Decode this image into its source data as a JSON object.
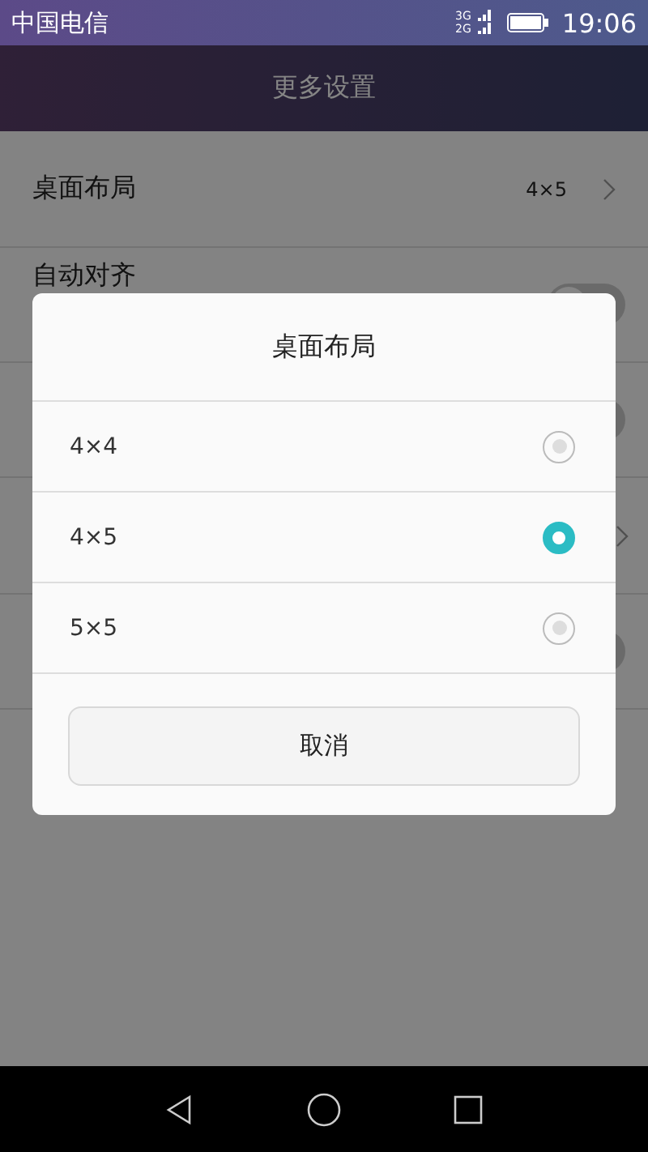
{
  "status_bar": {
    "carrier": "中国电信",
    "network_top": "3G",
    "network_bottom": "2G",
    "time": "19:06"
  },
  "header": {
    "title": "更多设置"
  },
  "settings": [
    {
      "kind": "value",
      "label": "桌面布局",
      "value": "4×5"
    },
    {
      "kind": "toggle",
      "label": "自动对齐",
      "on": false
    },
    {
      "kind": "toggle",
      "on": false
    },
    {
      "kind": "link"
    },
    {
      "kind": "toggle",
      "on": false
    }
  ],
  "dialog": {
    "title": "桌面布局",
    "options": [
      {
        "label": "4×4",
        "selected": false
      },
      {
        "label": "4×5",
        "selected": true
      },
      {
        "label": "5×5",
        "selected": false
      }
    ],
    "cancel": "取消"
  }
}
